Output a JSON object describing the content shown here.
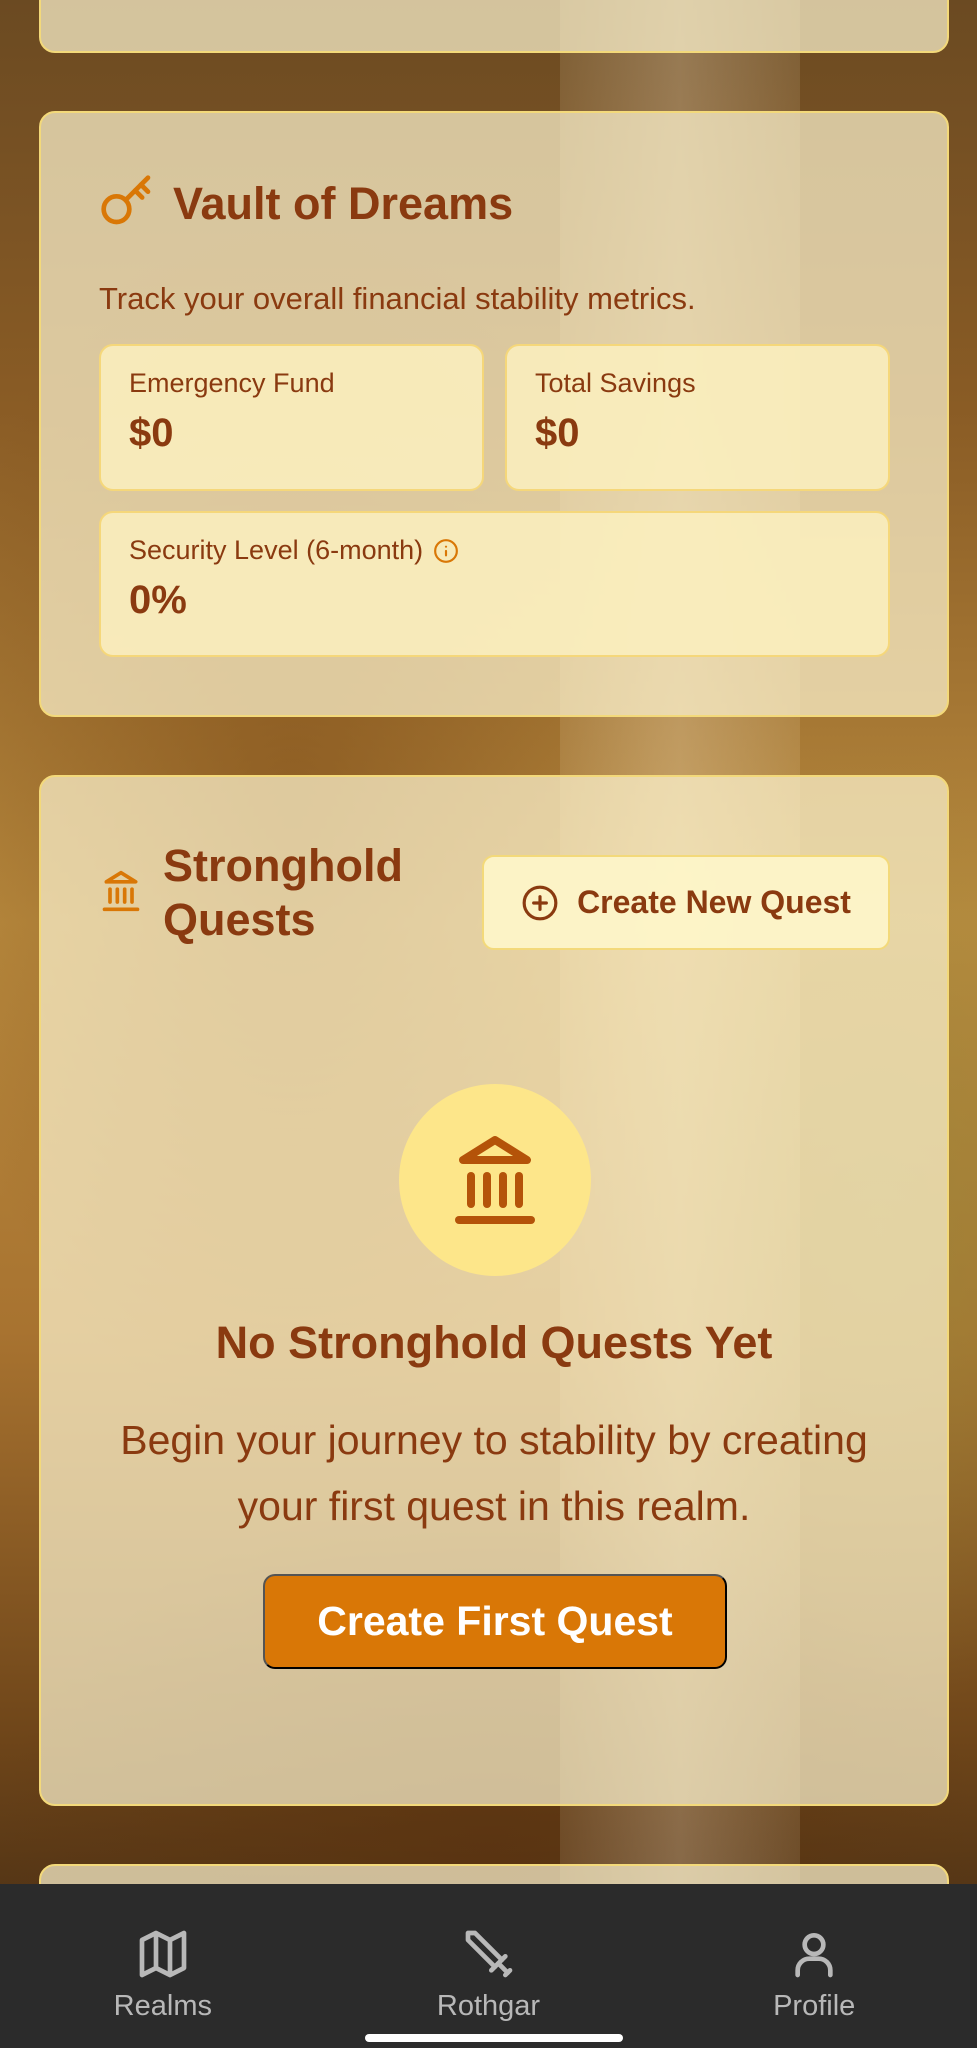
{
  "vault": {
    "title": "Vault of Dreams",
    "subtitle": "Track your overall financial stability metrics.",
    "stats": [
      {
        "label": "Emergency Fund",
        "value": "$0"
      },
      {
        "label": "Total Savings",
        "value": "$0"
      },
      {
        "label": "Security Level (6-month)",
        "value": "0%"
      }
    ]
  },
  "quests": {
    "title": "Stronghold Quests",
    "create_new_label": "Create New Quest",
    "empty_title": "No Stronghold Quests Yet",
    "empty_text": "Begin your journey to stability by creating your first quest in this realm.",
    "create_first_label": "Create First Quest"
  },
  "nav": {
    "items": [
      {
        "label": "Realms",
        "icon": "map-icon"
      },
      {
        "label": "Rothgar",
        "icon": "sword-icon"
      },
      {
        "label": "Profile",
        "icon": "user-icon"
      }
    ]
  },
  "colors": {
    "accent": "#d97706",
    "text": "#8a3a10",
    "card_border": "#f3d97a",
    "icon_bg": "#fde68a",
    "nav_bg": "#2b2b2b"
  }
}
